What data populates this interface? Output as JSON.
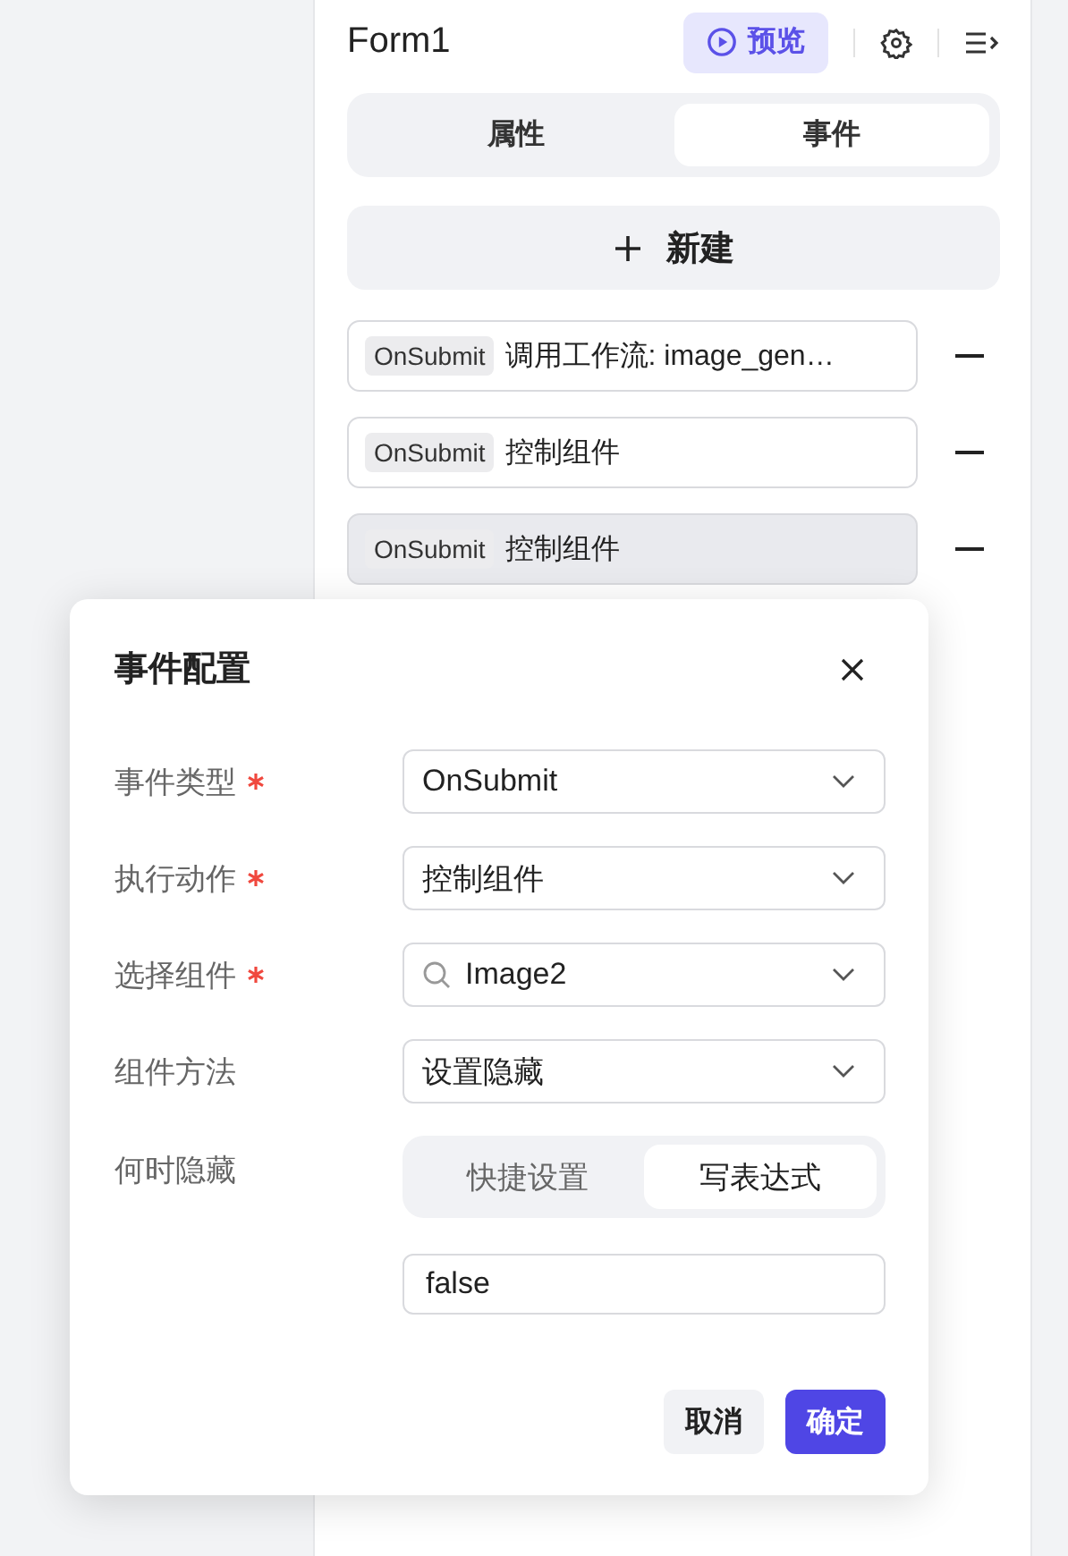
{
  "header": {
    "title": "Form1",
    "preview_button": "预览"
  },
  "tabs": [
    {
      "label": "属性",
      "selected": false
    },
    {
      "label": "事件",
      "selected": true
    }
  ],
  "new_button": {
    "label": "新建"
  },
  "events": [
    {
      "event": "OnSubmit",
      "action": "调用工作流: image_gen…",
      "selected": false
    },
    {
      "event": "OnSubmit",
      "action": "控制组件",
      "selected": false
    },
    {
      "event": "OnSubmit",
      "action": "控制组件",
      "selected": true
    }
  ],
  "dialog": {
    "title": "事件配置",
    "fields": [
      {
        "kind": "select",
        "label": "事件类型",
        "required": true,
        "value": "OnSubmit"
      },
      {
        "kind": "select",
        "label": "执行动作",
        "required": true,
        "value": "控制组件"
      },
      {
        "kind": "search-select",
        "label": "选择组件",
        "required": true,
        "value": "Image2"
      },
      {
        "kind": "select",
        "label": "组件方法",
        "required": false,
        "value": "设置隐藏"
      },
      {
        "kind": "expression",
        "label": "何时隐藏",
        "required": false,
        "modes": [
          {
            "label": "快捷设置",
            "selected": false
          },
          {
            "label": "写表达式",
            "selected": true
          }
        ],
        "value": "false"
      }
    ],
    "buttons": [
      {
        "kind": "secondary",
        "label": "取消"
      },
      {
        "kind": "primary",
        "label": "确定"
      }
    ]
  }
}
